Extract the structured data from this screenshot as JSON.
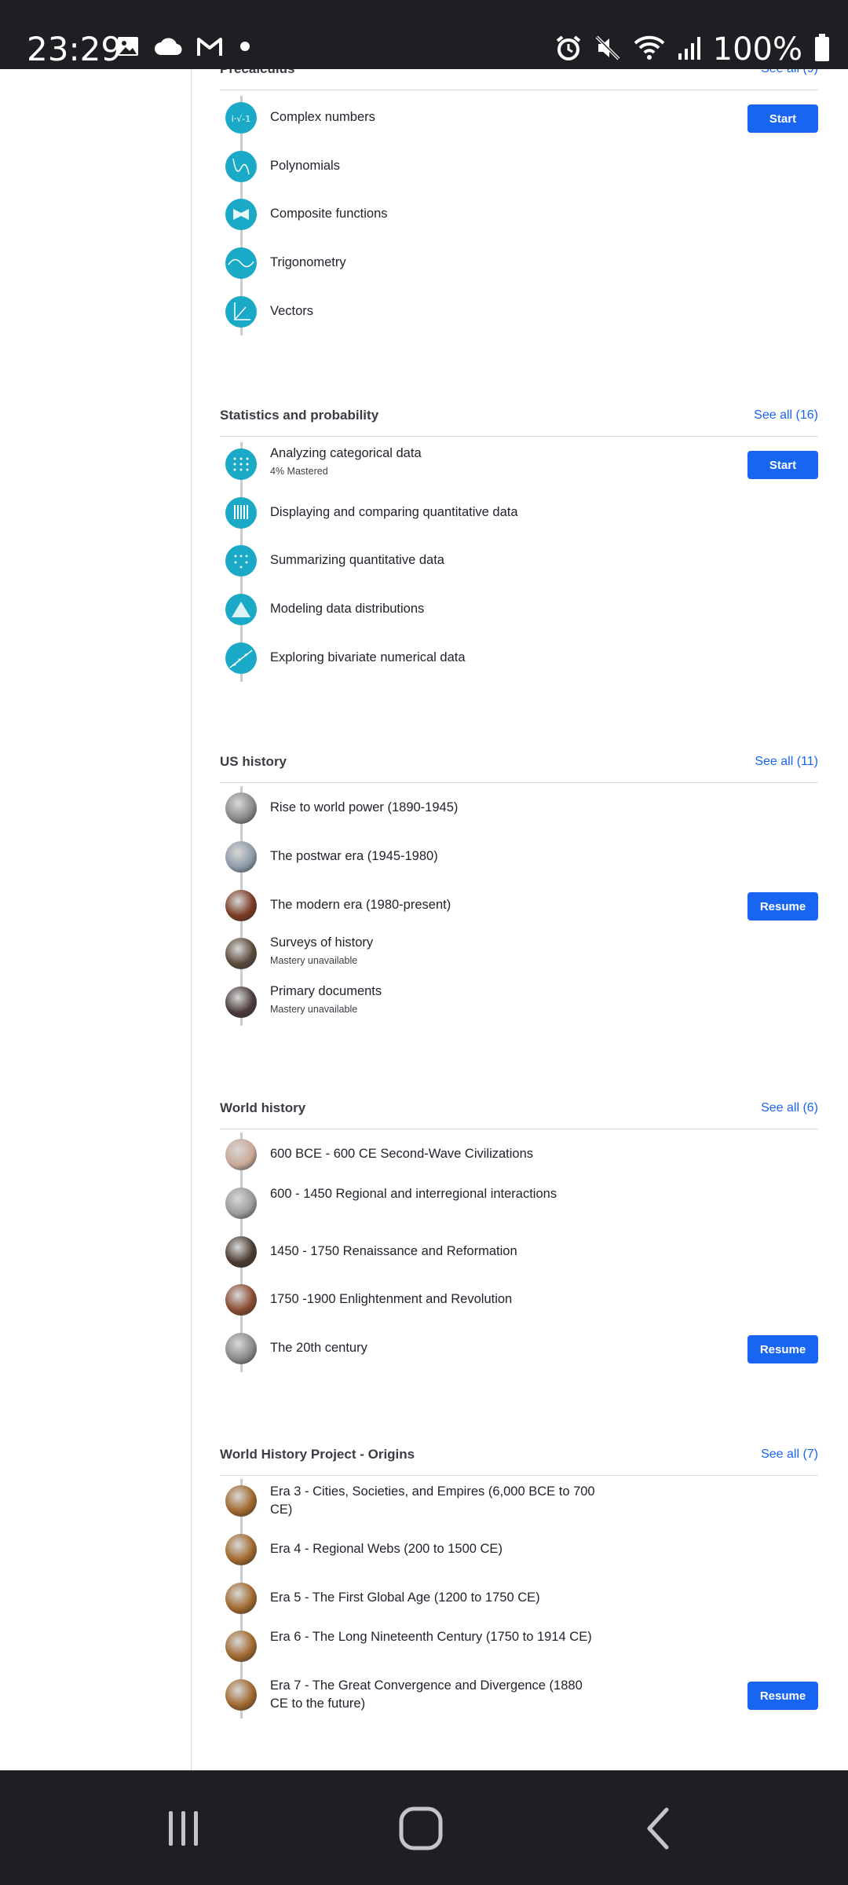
{
  "status_bar": {
    "time": "23:29",
    "battery": "100%",
    "left_icons": [
      "gallery-icon",
      "cloud-icon",
      "gmail-icon",
      "dot-icon"
    ],
    "right_icons": [
      "alarm-icon",
      "mute-icon",
      "wifi-icon",
      "signal-icon",
      "battery-icon"
    ]
  },
  "sections": [
    {
      "title": "Precalculus",
      "see_all": "See all (9)",
      "items": [
        {
          "label": "Complex numbers",
          "sub": "",
          "button": "Start"
        },
        {
          "label": "Polynomials",
          "sub": "",
          "button": ""
        },
        {
          "label": "Composite functions",
          "sub": "",
          "button": ""
        },
        {
          "label": "Trigonometry",
          "sub": "",
          "button": ""
        },
        {
          "label": "Vectors",
          "sub": "",
          "button": ""
        }
      ]
    },
    {
      "title": "Statistics and probability",
      "see_all": "See all (16)",
      "items": [
        {
          "label": "Analyzing categorical data",
          "sub": "4% Mastered",
          "button": "Start"
        },
        {
          "label": "Displaying and comparing quantitative data",
          "sub": "",
          "button": ""
        },
        {
          "label": "Summarizing quantitative data",
          "sub": "",
          "button": ""
        },
        {
          "label": "Modeling data distributions",
          "sub": "",
          "button": ""
        },
        {
          "label": "Exploring bivariate numerical data",
          "sub": "",
          "button": ""
        }
      ]
    },
    {
      "title": "US history",
      "see_all": "See all (11)",
      "items": [
        {
          "label": "Rise to world power (1890-1945)",
          "sub": "",
          "button": ""
        },
        {
          "label": "The postwar era (1945-1980)",
          "sub": "",
          "button": ""
        },
        {
          "label": "The modern era (1980-present)",
          "sub": "",
          "button": "Resume"
        },
        {
          "label": "Surveys of history",
          "sub": "Mastery unavailable",
          "button": ""
        },
        {
          "label": "Primary documents",
          "sub": "Mastery unavailable",
          "button": ""
        }
      ]
    },
    {
      "title": "World history",
      "see_all": "See all (6)",
      "items": [
        {
          "label": "600 BCE - 600 CE Second-Wave Civilizations",
          "sub": "",
          "button": ""
        },
        {
          "label": "600 - 1450 Regional and interregional interactions",
          "sub": "",
          "button": ""
        },
        {
          "label": "1450 - 1750 Renaissance and Reformation",
          "sub": "",
          "button": ""
        },
        {
          "label": "1750 -1900 Enlightenment and Revolution",
          "sub": "",
          "button": ""
        },
        {
          "label": "The 20th century",
          "sub": "",
          "button": "Resume"
        }
      ]
    },
    {
      "title": "World History Project - Origins",
      "see_all": "See all (7)",
      "items": [
        {
          "label": "Era 3 - Cities, Societies, and Empires (6,000 BCE to 700 CE)",
          "sub": "",
          "button": ""
        },
        {
          "label": "Era 4 - Regional Webs (200 to 1500 CE)",
          "sub": "",
          "button": ""
        },
        {
          "label": "Era 5 - The First Global Age (1200 to 1750 CE)",
          "sub": "",
          "button": ""
        },
        {
          "label": "Era 6 - The Long Nineteenth Century (1750 to 1914 CE)",
          "sub": "",
          "button": ""
        },
        {
          "label": "Era 7 - The Great Convergence and Divergence (1880 CE to the future)",
          "sub": "",
          "button": "Resume"
        }
      ]
    }
  ],
  "nav_bar": {
    "buttons": [
      "recents-icon",
      "home-icon",
      "back-icon"
    ]
  },
  "colors": {
    "accent": "#1865f2",
    "math_icon": "#1aa9c7",
    "system_bar": "#1f1f23"
  }
}
